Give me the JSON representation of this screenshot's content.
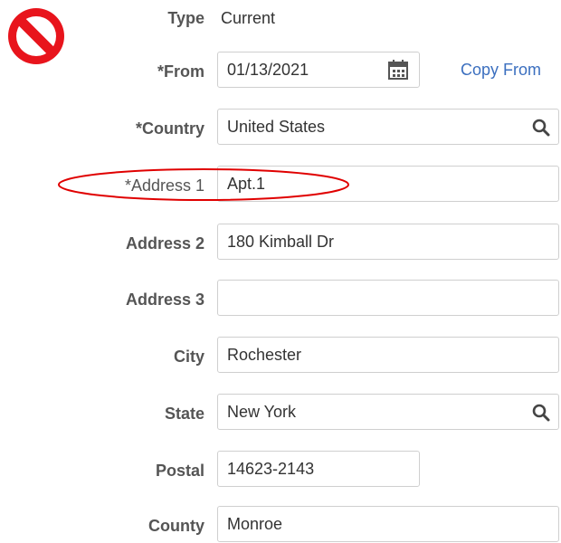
{
  "header": {
    "type_label": "Type",
    "type_value": "Current",
    "no_icon": "prohibited-icon"
  },
  "fields": {
    "from": {
      "label": "*From",
      "value": "01/13/2021",
      "icon": "calendar-icon"
    },
    "copy_from": "Copy From",
    "country": {
      "label": "*Country",
      "value": "United States",
      "icon": "search-icon"
    },
    "address1": {
      "label": "*Address 1",
      "value": "Apt.1"
    },
    "address2": {
      "label": "Address 2",
      "value": "180 Kimball Dr"
    },
    "address3": {
      "label": "Address 3",
      "value": ""
    },
    "city": {
      "label": "City",
      "value": "Rochester"
    },
    "state": {
      "label": "State",
      "value": "New York",
      "icon": "search-icon"
    },
    "postal": {
      "label": "Postal",
      "value": "14623-2143"
    },
    "county": {
      "label": "County",
      "value": "Monroe"
    }
  },
  "colors": {
    "annotation": "#e00000",
    "link": "#3b6fbf",
    "label": "#555555"
  }
}
